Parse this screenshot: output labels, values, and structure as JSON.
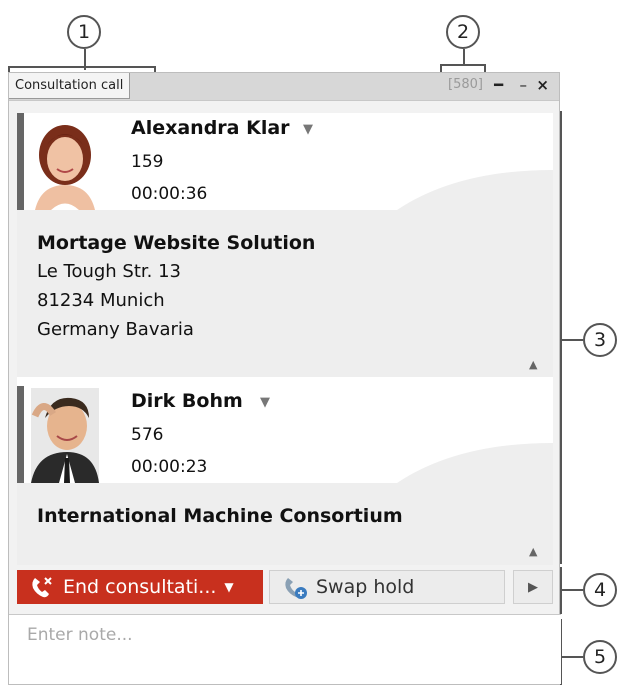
{
  "window": {
    "title": "Consultation call",
    "id_badge": "[580]",
    "pin_glyph": "━",
    "minimize_glyph": "–",
    "close_glyph": "×"
  },
  "callouts": [
    "1",
    "2",
    "3",
    "4",
    "5"
  ],
  "calls": [
    {
      "name": "Alexandra Klar",
      "number": "159",
      "duration": "00:00:36",
      "company": "Mortage Website Solution",
      "address": [
        "Le Tough Str. 13",
        "81234 Munich",
        "Germany Bavaria"
      ]
    },
    {
      "name": "Dirk Bohm",
      "number": "576",
      "duration": "00:00:23",
      "company": "International Machine Consortium"
    }
  ],
  "actions": {
    "end_label": "End consultati...",
    "swap_label": "Swap hold"
  },
  "note": {
    "placeholder": "Enter note..."
  },
  "icons": {
    "dropdown": "▼",
    "expand": "▲",
    "more": "▶"
  },
  "colors": {
    "end_button": "#c8301e",
    "accent_bar": "#666666"
  }
}
